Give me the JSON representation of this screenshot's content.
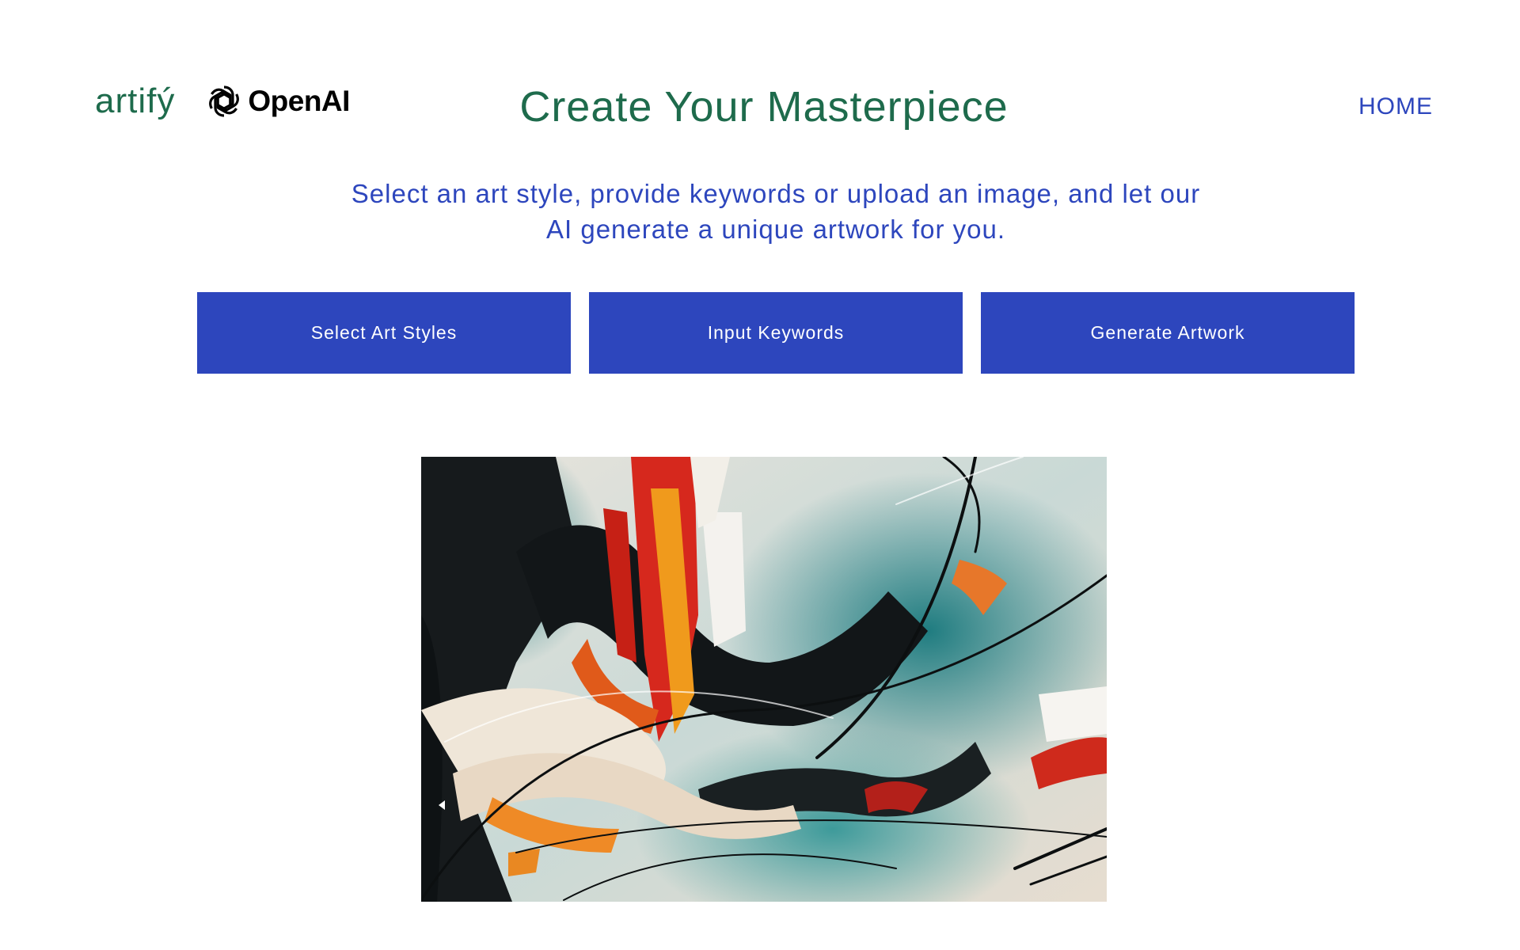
{
  "header": {
    "brand_name": "artifý",
    "partner_logo_text": "OpenAI",
    "title": "Create Your Masterpiece",
    "nav_home": "HOME"
  },
  "intro": {
    "line1": "Select an art style, provide keywords or upload an image, and let our",
    "line2": "AI generate a unique artwork for you."
  },
  "actions": {
    "select_styles": "Select Art Styles",
    "input_keywords": "Input Keywords",
    "generate": "Generate Artwork"
  },
  "colors": {
    "brand_green": "#1e6b4c",
    "accent_blue": "#2d46bd",
    "background": "#ffffff"
  },
  "icons": {
    "partner_logo": "openai-logo-icon"
  }
}
